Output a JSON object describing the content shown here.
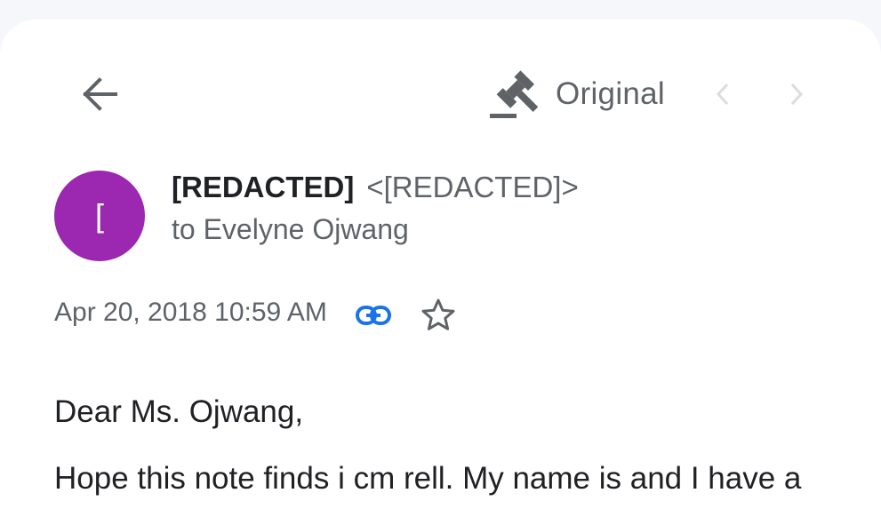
{
  "toolbar": {
    "back_icon": "arrow-left-icon",
    "original_icon": "gavel-icon",
    "original_label": "Original",
    "prev_icon": "chevron-left-icon",
    "next_icon": "chevron-right-icon"
  },
  "sender": {
    "avatar_letter": "[",
    "avatar_color": "#9c27b0",
    "name": "[REDACTED]",
    "email": "<[REDACTED]>",
    "recipient": "to Evelyne Ojwang"
  },
  "meta": {
    "date": "Apr 20, 2018 10:59 AM",
    "link_icon": "link-icon",
    "star_icon": "star-outline-icon",
    "link_color": "#1a73e8"
  },
  "body": {
    "greeting": "Dear Ms. Ojwang,",
    "line1": "Hope this note finds i cm rell. My name is and I have a"
  }
}
